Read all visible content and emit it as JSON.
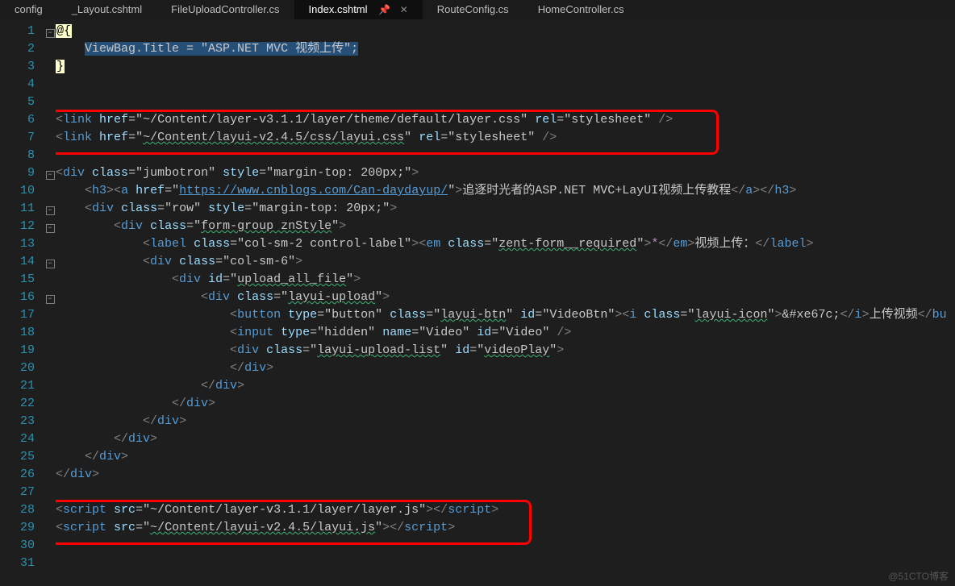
{
  "tabs": [
    {
      "label": "config"
    },
    {
      "label": "_Layout.cshtml"
    },
    {
      "label": "FileUploadController.cs"
    },
    {
      "label": "Index.cshtml",
      "active": true,
      "pin": "📌",
      "close": "✕"
    },
    {
      "label": "RouteConfig.cs"
    },
    {
      "label": "HomeController.cs"
    }
  ],
  "line_count": 31,
  "razor": {
    "open": "@{",
    "close": "}",
    "stmt_pre": "ViewBag.Title = ",
    "stmt_str": "\"ASP.NET MVC 视频上传\"",
    "stmt_end": ";"
  },
  "link1": {
    "href": "~/Content/layer-v3.1.1/layer/theme/default/layer.css",
    "rel": "stylesheet"
  },
  "link2": {
    "href": "~/Content/layui-v2.4.5/css/layui.css",
    "rel": "stylesheet"
  },
  "div9": {
    "class": "jumbotron",
    "style": "margin-top: 200px;"
  },
  "l10": {
    "href": "https://www.cnblogs.com/Can-daydayup/",
    "text": "追逐时光者的ASP.NET MVC+LayUI视频上传教程"
  },
  "div11": {
    "class": "row",
    "style": "margin-top: 20px;"
  },
  "div12": {
    "class": "form-group znStyle"
  },
  "lbl13": {
    "class": "col-sm-2 control-label",
    "emclass": "zent-form__required",
    "star": "*",
    "text": "视频上传："
  },
  "div14": {
    "class": "col-sm-6"
  },
  "div15": {
    "id": "upload_all_file"
  },
  "div16": {
    "class": "layui-upload"
  },
  "btn17": {
    "type": "button",
    "class": "layui-btn",
    "id": "VideoBtn",
    "iclass": "layui-icon",
    "icon": "&#xe67c;",
    "text": "上传视频"
  },
  "inp18": {
    "type": "hidden",
    "name": "Video",
    "id": "Video"
  },
  "div19": {
    "class": "layui-upload-list",
    "id": "videoPlay"
  },
  "s28": {
    "src": "~/Content/layer-v3.1.1/layer/layer.js"
  },
  "s29": {
    "src": "~/Content/layui-v2.4.5/layui.js"
  },
  "watermark": "@51CTO博客"
}
